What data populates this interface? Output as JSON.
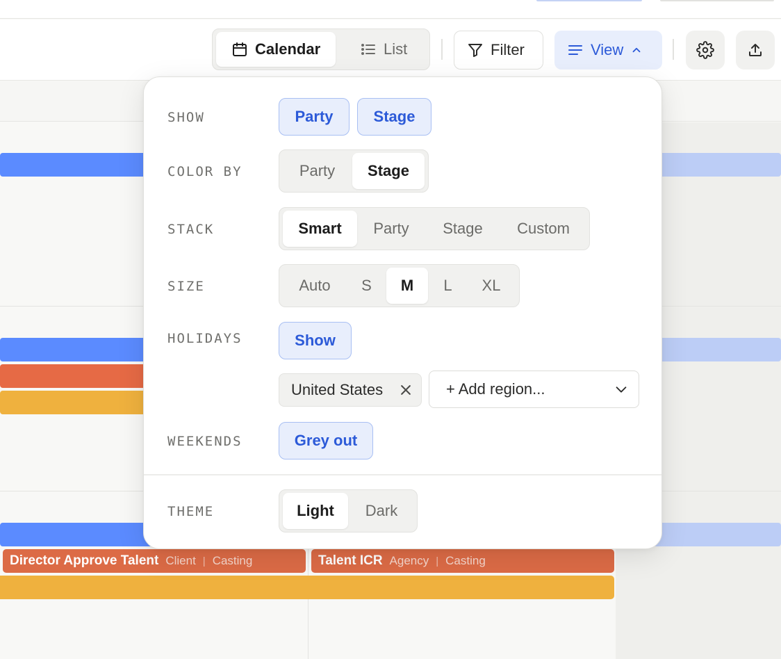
{
  "toolbar": {
    "calendar_label": "Calendar",
    "list_label": "List",
    "filter_label": "Filter",
    "view_label": "View"
  },
  "view_menu": {
    "show": {
      "label": "SHOW",
      "options": [
        "Party",
        "Stage"
      ]
    },
    "color_by": {
      "label": "COLOR BY",
      "options": [
        "Party",
        "Stage"
      ],
      "selected": "Stage"
    },
    "stack": {
      "label": "STACK",
      "options": [
        "Smart",
        "Party",
        "Stage",
        "Custom"
      ],
      "selected": "Smart"
    },
    "size": {
      "label": "SIZE",
      "options": [
        "Auto",
        "S",
        "M",
        "L",
        "XL"
      ],
      "selected": "M"
    },
    "holidays": {
      "label": "HOLIDAYS",
      "toggle": "Show",
      "regions": [
        "United States"
      ],
      "add_region_placeholder": "+ Add region..."
    },
    "weekends": {
      "label": "WEEKENDS",
      "toggle": "Grey out"
    },
    "theme": {
      "label": "THEME",
      "options": [
        "Light",
        "Dark"
      ],
      "selected": "Light"
    }
  },
  "events": [
    {
      "title": "Director Approve Talent",
      "party": "Client",
      "stage": "Casting"
    },
    {
      "title": "Talent ICR",
      "party": "Agency",
      "stage": "Casting"
    }
  ],
  "colors": {
    "accent": "#2c5ad8",
    "accent_bg": "#e8eefc",
    "bar_blue": "#5b8bff",
    "bar_orange": "#e66a45",
    "bar_yellow": "#efb13e"
  }
}
